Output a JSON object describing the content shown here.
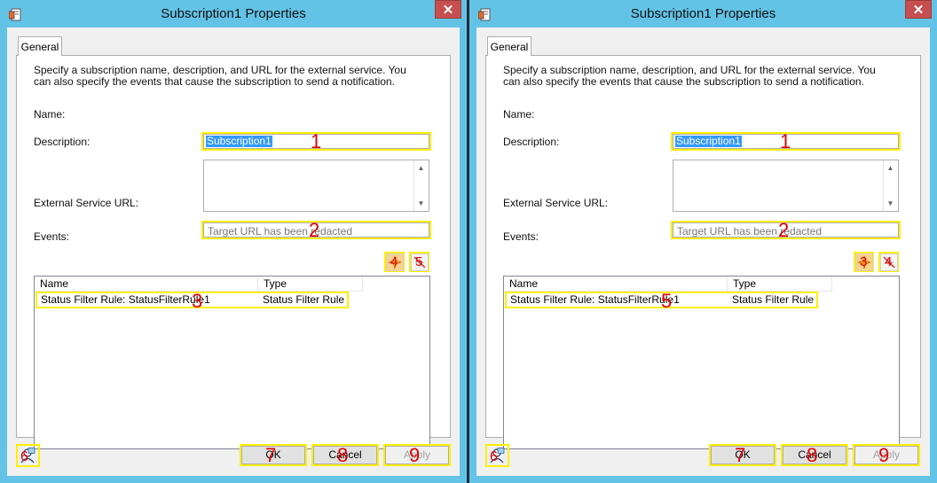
{
  "dialog": {
    "title": "Subscription1 Properties",
    "close_glyph": "✕",
    "tab": "General",
    "description": "Specify a subscription name, description, and URL for the external service. You can also specify the events that cause the subscription to send a notification.",
    "name_label": "Name:",
    "name_value": "Subscription1",
    "description_label": "Description:",
    "url_label": "External Service URL:",
    "url_value": "Target URL has been redacted",
    "events_label": "Events:",
    "columns": [
      "Name",
      "Type"
    ],
    "event_row": {
      "name": "Status Filter Rule: StatusFilterRule1",
      "type": "Status Filter Rule"
    },
    "ok": "OK",
    "cancel": "Cancel",
    "apply": "Apply"
  },
  "annotations_left": {
    "name": "1",
    "url": "2",
    "row": "3",
    "add": "4",
    "remove": "5",
    "help": "6",
    "ok": "7",
    "cancel": "8",
    "apply": "9"
  },
  "annotations_right": {
    "name": "1",
    "url": "2",
    "row": "5",
    "add": "3",
    "remove": "4",
    "help": "6",
    "ok": "7",
    "cancel": "8",
    "apply": "9"
  },
  "colors": {
    "title_bar": "#63c3e6",
    "close_button": "#c74f4f",
    "highlight": "#ffef00",
    "annotation": "#e00000",
    "selection": "#3399ff"
  },
  "icons": {
    "app": "properties-icon",
    "add_event": "add-event-icon",
    "remove_event": "remove-event-icon",
    "help": "help-icon"
  }
}
